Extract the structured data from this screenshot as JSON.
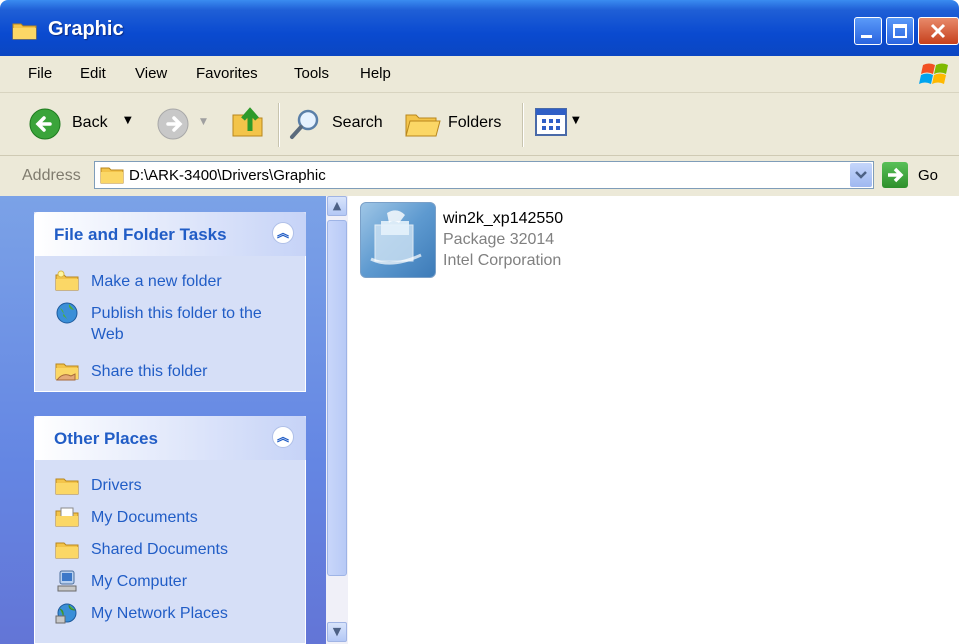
{
  "window": {
    "title": "Graphic"
  },
  "menu": [
    "File",
    "Edit",
    "View",
    "Favorites",
    "Tools",
    "Help"
  ],
  "toolbar": {
    "back_label": "Back",
    "search_label": "Search",
    "folders_label": "Folders"
  },
  "address": {
    "label": "Address",
    "path": "D:\\ARK-3400\\Drivers\\Graphic",
    "go_label": "Go"
  },
  "tasks_panel": {
    "title": "File and Folder Tasks",
    "items": [
      {
        "label": "Make a new folder",
        "icon": "new-folder-icon"
      },
      {
        "label": "Publish this folder to the Web",
        "icon": "publish-web-icon"
      },
      {
        "label": "Share this folder",
        "icon": "share-folder-icon"
      }
    ]
  },
  "places_panel": {
    "title": "Other Places",
    "items": [
      {
        "label": "Drivers",
        "icon": "folder-icon"
      },
      {
        "label": "My Documents",
        "icon": "my-documents-icon"
      },
      {
        "label": "Shared Documents",
        "icon": "folder-icon"
      },
      {
        "label": "My Computer",
        "icon": "my-computer-icon"
      },
      {
        "label": "My Network Places",
        "icon": "network-places-icon"
      }
    ]
  },
  "files": [
    {
      "name": "win2k_xp142550",
      "type": "Package 32014",
      "company": "Intel Corporation"
    }
  ],
  "colors": {
    "titlebar": "#0a4ad0",
    "panel_title": "#215dc6",
    "sidebar": "#6b8fe3",
    "chrome": "#ece9d8"
  }
}
